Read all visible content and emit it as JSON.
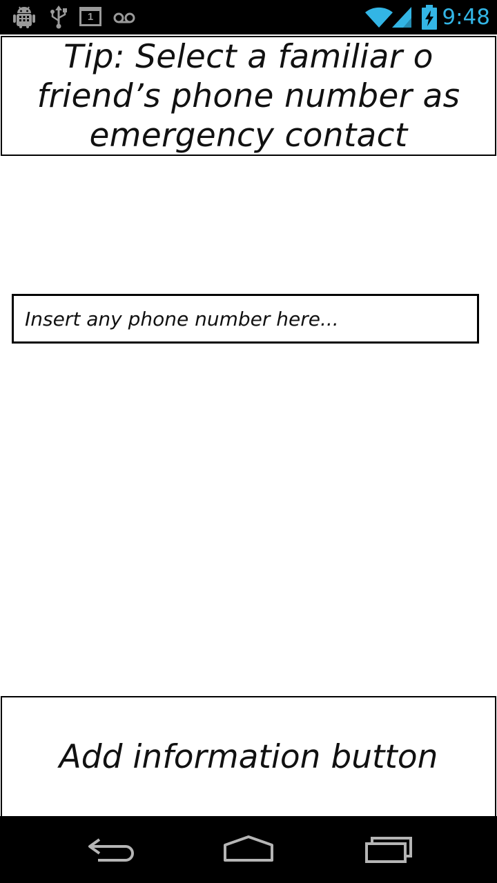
{
  "status_bar": {
    "time": "9:48",
    "notification_icons": [
      "android-debug-icon",
      "usb-icon",
      "calendar-icon",
      "voicemail-icon"
    ],
    "calendar_day": "1",
    "accent_color": "#33b5e5"
  },
  "tip": {
    "text": "Tip: Select a familiar o friend’s phone number as emergency contact"
  },
  "phone_input": {
    "placeholder": "Insert any phone number here...",
    "value": ""
  },
  "add_button": {
    "label": "Add information button"
  },
  "nav_bar": {
    "buttons": [
      "back-icon",
      "home-icon",
      "recent-apps-icon"
    ]
  }
}
